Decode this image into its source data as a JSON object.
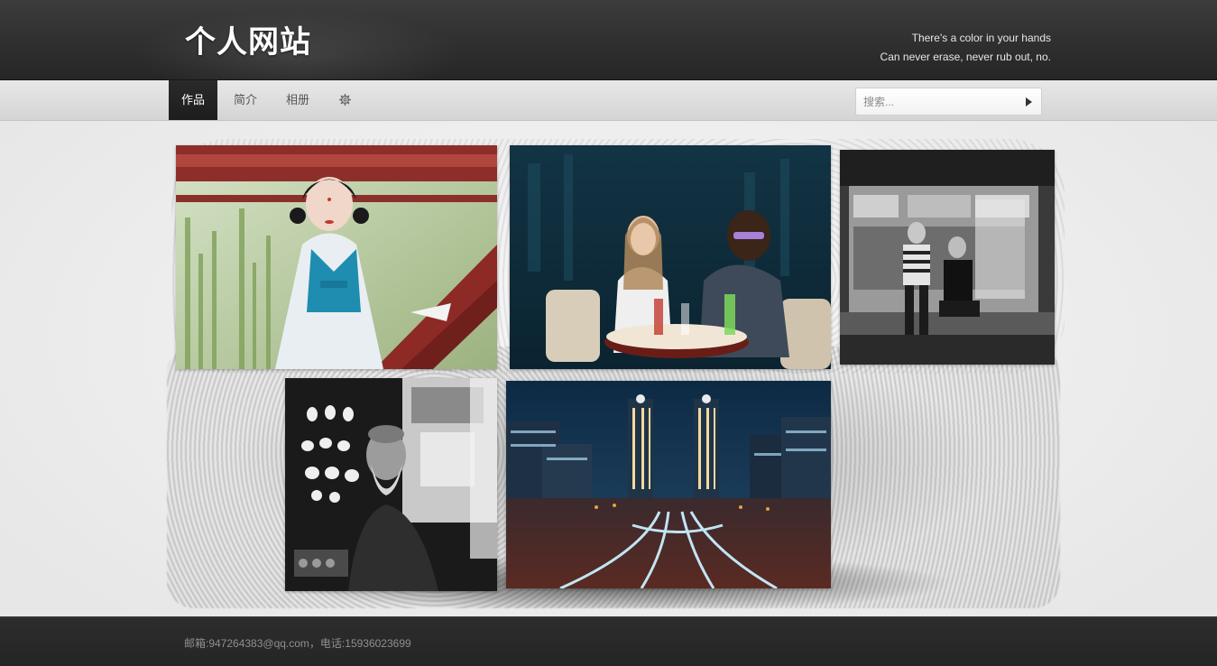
{
  "header": {
    "logo_text": "个人网站",
    "tagline_line1": "There's a color in your hands",
    "tagline_line2": "Can never erase, never rub out, no."
  },
  "nav": {
    "items": [
      {
        "label": "作品",
        "active": true
      },
      {
        "label": "简介",
        "active": false
      },
      {
        "label": "相册",
        "active": false
      }
    ],
    "settings_icon": "gear-icon",
    "search_placeholder": "搜索...",
    "search_button_icon": "play-arrow-icon"
  },
  "gallery": {
    "photos": [
      {
        "subject": "woman in hanfu by red railing"
      },
      {
        "subject": "two women at a bar table"
      },
      {
        "subject": "black and white street shop with two men"
      },
      {
        "subject": "black and white portrait of elderly man"
      },
      {
        "subject": "city night towers with light trails"
      }
    ]
  },
  "footer": {
    "text": "邮箱:947264383@qq.com，电话:15936023699"
  },
  "colors": {
    "header_bg": "#2e2e2e",
    "nav_bg": "#dcdcdc",
    "nav_active_bg": "#222222",
    "page_bg": "#ececec",
    "footer_bg": "#292929"
  }
}
